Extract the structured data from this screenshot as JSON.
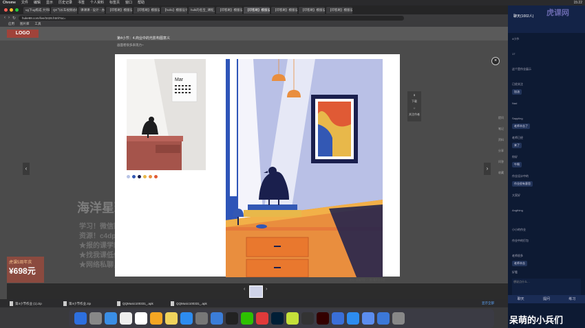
{
  "menubar": {
    "app": "Chrome",
    "items": [
      "文件",
      "编辑",
      "显示",
      "历史记录",
      "书签",
      "个人资料",
      "标签页",
      "窗口",
      "帮助"
    ],
    "right": "15:22"
  },
  "tabs": [
    "ug下ug练成 大师班 - 中",
    "Q0飞长车视频总体行+",
    "课课课 - 设计 - 办公专区",
    "【印客刷】模版设计",
    "【印客刷】模版设计",
    "【hollo】模版设计 - 【",
    "hulk的名宝_课程_ 页-",
    "【印客刷】模版设计",
    "【印客刷】模版设计",
    "【印客刷】模版设计",
    "【印客刷】模版设计",
    "【印客刷】模版设计"
  ],
  "url": "huke88.com/live/3428.html?ac=",
  "bookmarks": [
    "应用",
    "图片库",
    "工具"
  ],
  "site": {
    "logo": "LOGO"
  },
  "modal": {
    "title": "第4小节：4.商业中的光影构图意义",
    "subtitle": "画面者很多表现力~",
    "close": "×",
    "prev": "‹",
    "next": "›",
    "caption": "图片: 插画作业 ＞ 第1课作业作品"
  },
  "tools": [
    "下载",
    "关注作者"
  ],
  "watermark": {
    "main": "海洋星球",
    "lines": [
      "学习！微信购买",
      "资源！c4dpro998",
      "★报的课学就费买！浪费！",
      "★找我课低价格钱，免费！",
      "★网络私聊，私聊有惊喜！"
    ]
  },
  "promo": {
    "title": "虎课5周年庆",
    "price": "¥698元"
  },
  "calendar": {
    "month": "Mar"
  },
  "swatch_colors": [
    "#b8c4e6",
    "#3358b4",
    "#1a1f4d",
    "#e8b84a",
    "#e98e3e",
    "#e05a35"
  ],
  "side_labels": [
    "提问",
    "笔记",
    "资料",
    "分享",
    "问答",
    "收藏"
  ],
  "downloads": [
    {
      "name": "第4小节作业 (1).zip",
      "sub": "已完成"
    },
    {
      "name": "第4小节作业.zip",
      "sub": ""
    },
    {
      "name": "QQMusic100331_.apk",
      "sub": ""
    },
    {
      "name": "QQMusic100331_.apk",
      "sub": ""
    }
  ],
  "downloads_all": "显示全部",
  "chat": {
    "title": "聊天(1002人)",
    "brand": "虎课网",
    "messages": [
      "4小节",
      "17",
      "这个是作业展示",
      "已经关注",
      "Nad",
      "Sappling",
      "老师已经",
      "你好",
      "作业设计中的",
      "大家好",
      "Angthing",
      "小小的作业",
      "作业中的打包",
      "老师很多",
      "好看",
      "老师说过"
    ],
    "bubbles": [
      "加油",
      "老师辛苦了",
      "来了",
      "牛啊",
      "作业很有意思",
      "老师辛苦"
    ],
    "input_placeholder": "想说点什么…",
    "tabs": [
      "聊天",
      "提问",
      "练习"
    ]
  },
  "overlay_text": "呆萌的小兵们"
}
